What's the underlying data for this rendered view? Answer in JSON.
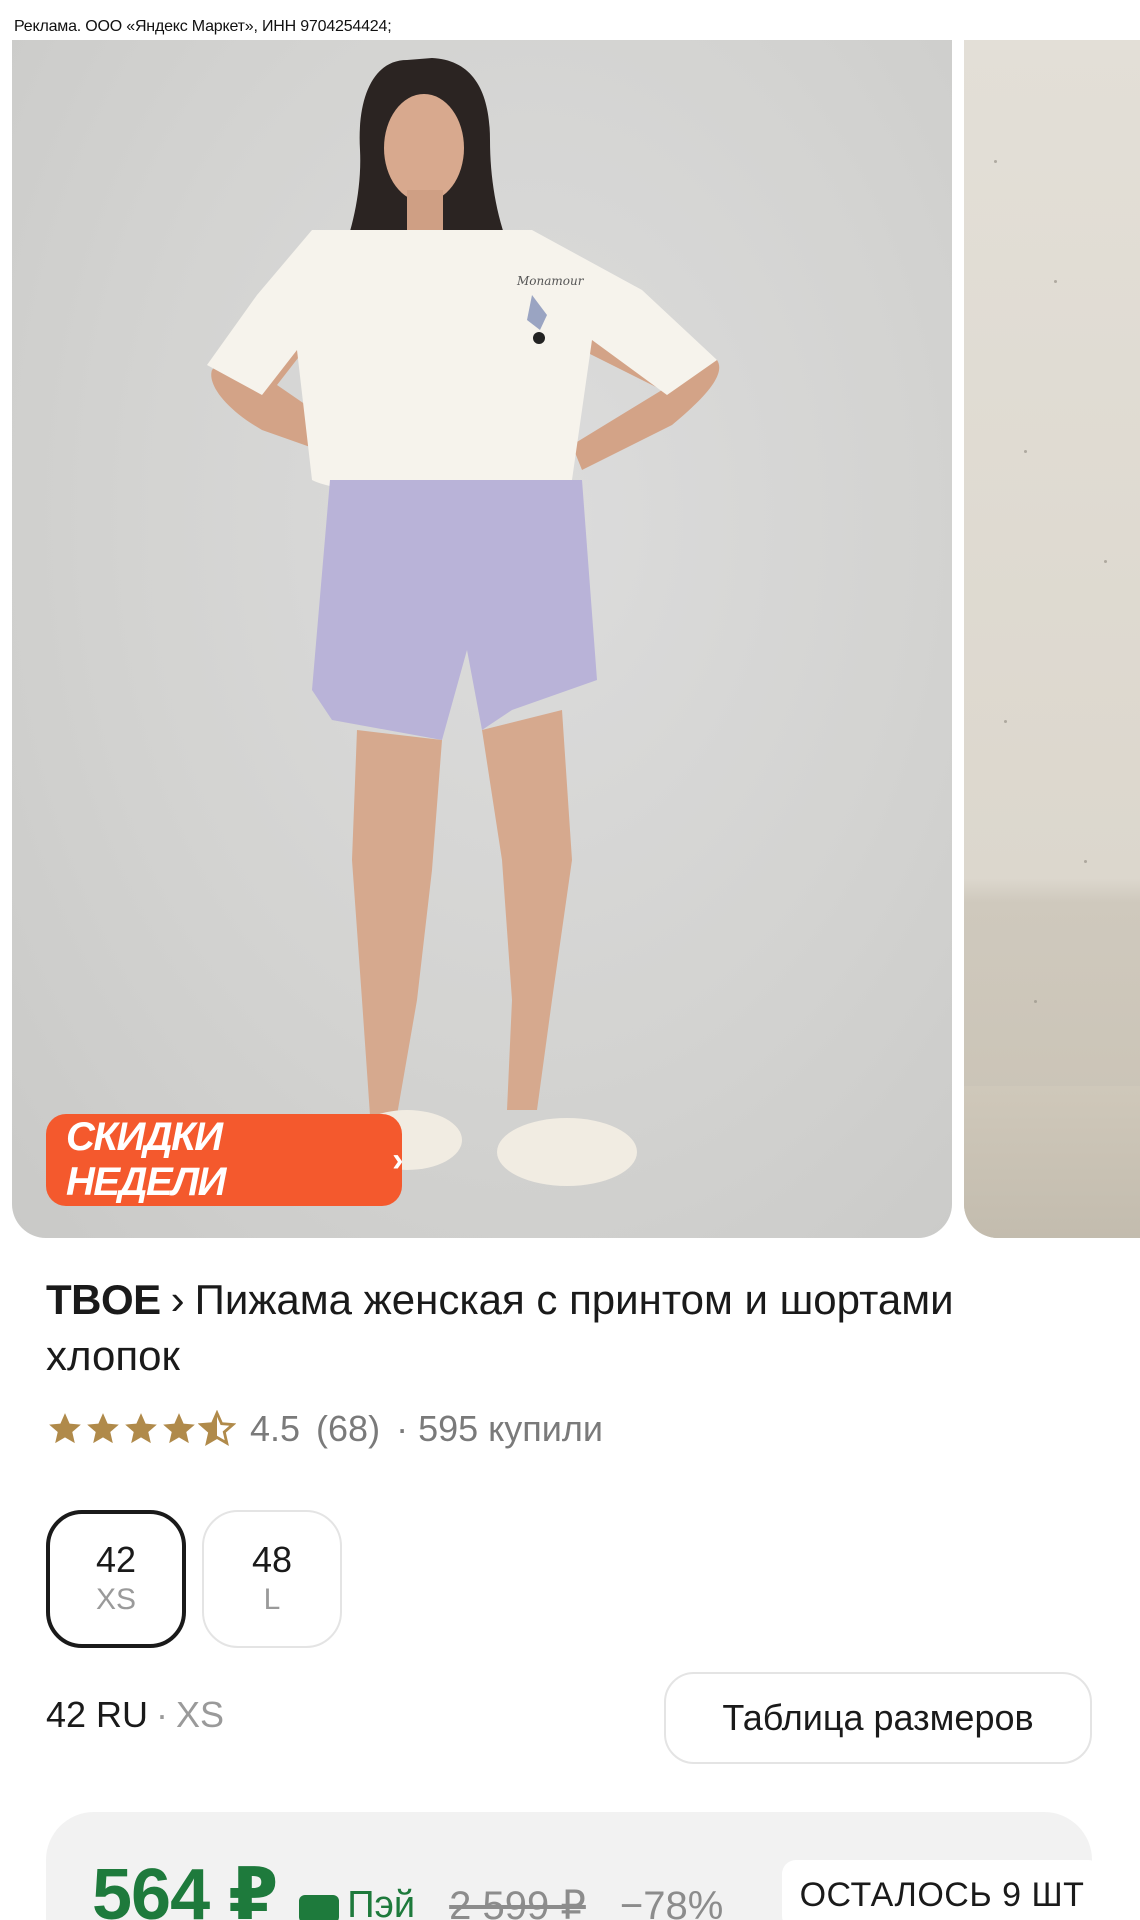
{
  "ad_disclaimer": "Реклама. ООО «Яндекс Маркет», ИНН 9704254424;",
  "gallery": {
    "main_photo_alt": "Женщина в белой футболке и сиреневых шортах",
    "promo_badge": "СКИДКИ НЕДЕЛИ",
    "promo_chevron": "›"
  },
  "product": {
    "brand": "TBOE",
    "separator": "›",
    "title": "Пижама женская с принтом и шортами хлопок"
  },
  "rating": {
    "stars": 4.5,
    "value": "4.5",
    "reviews": "(68)",
    "purchases": "· 595 купили",
    "star_color": "#b08a4a"
  },
  "sizes": [
    {
      "num": "42",
      "label": "XS",
      "selected": true
    },
    {
      "num": "48",
      "label": "L",
      "selected": false
    }
  ],
  "size_info": {
    "ru": "42 RU",
    "dot": "·",
    "letter": "XS"
  },
  "size_table_button": "Таблица размеров",
  "price": {
    "current": "564 ₽",
    "pay_label": "Пэй",
    "old": "2 599 ₽",
    "discount": "−78%",
    "stock": "ОСТАЛОСЬ 9 ШТ",
    "accent_color": "#1e7a3c"
  }
}
